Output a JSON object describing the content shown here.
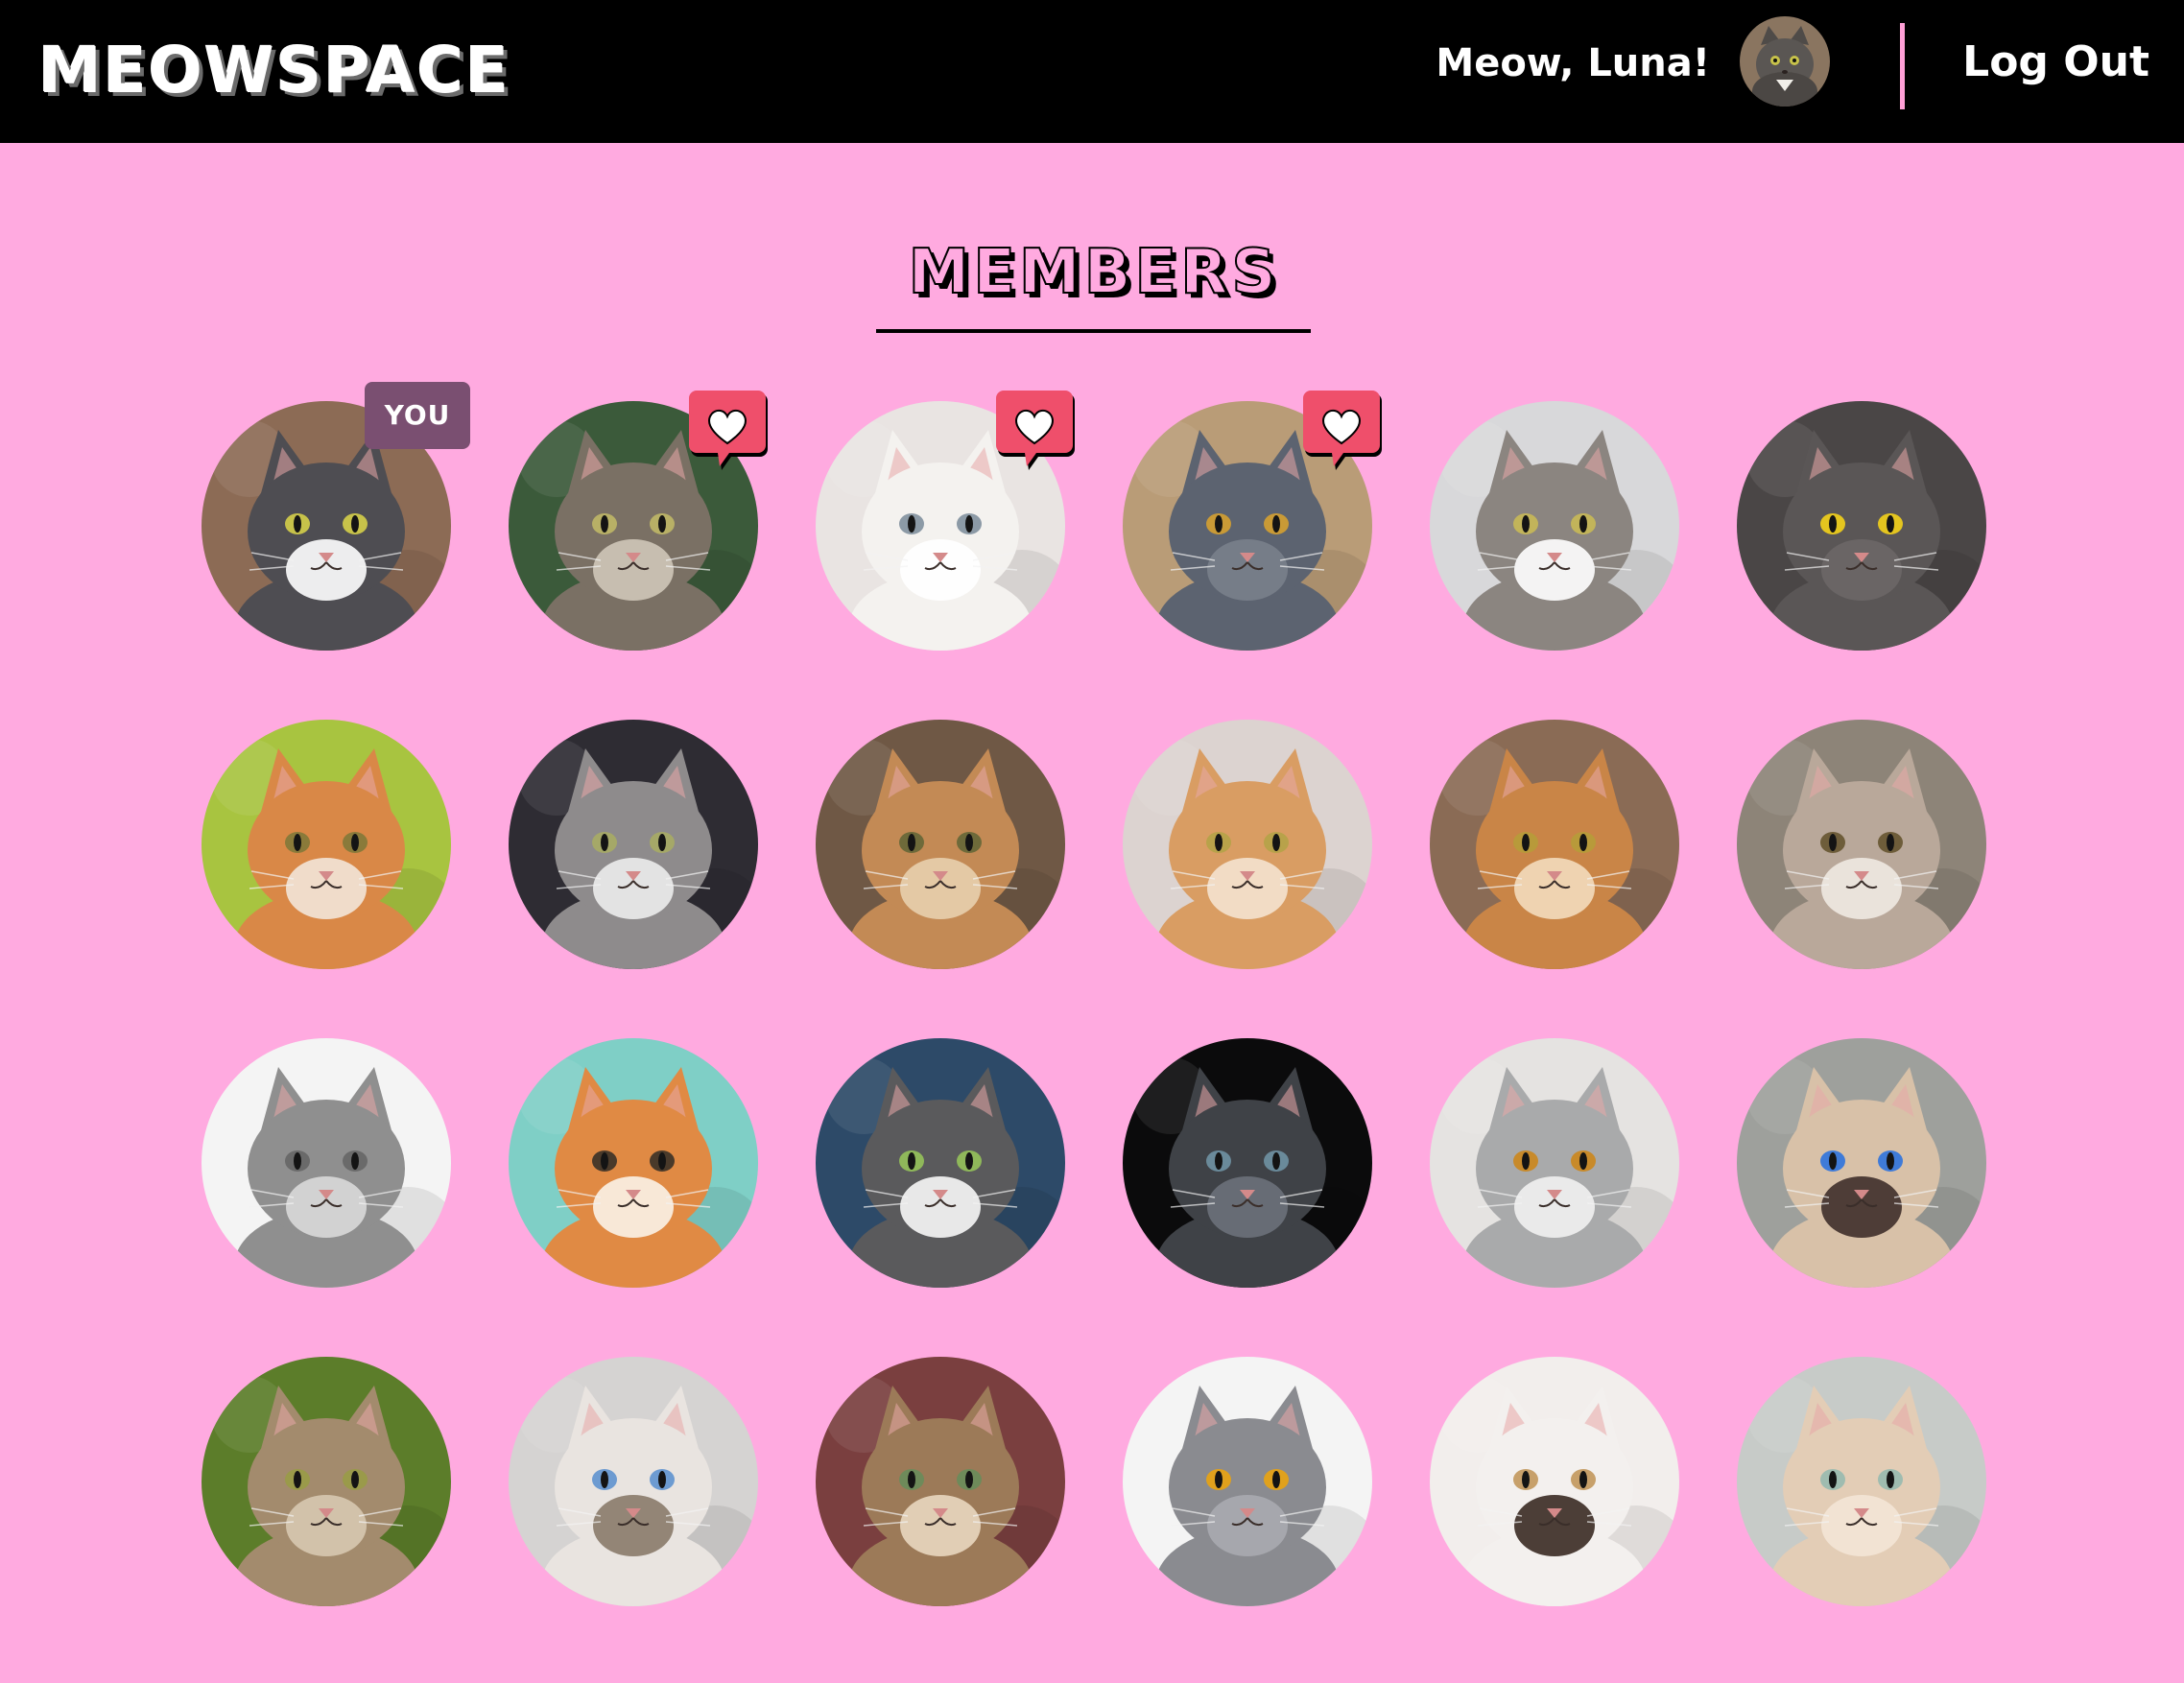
{
  "header": {
    "logo": "MEOWSPACE",
    "greeting": "Meow, Luna!",
    "logout_label": "Log Out",
    "avatar_icon": "cat-avatar-icon",
    "divider_color": "#ff9fd6"
  },
  "main": {
    "title": "MEMBERS",
    "you_badge": "YOU",
    "background_color": "#ffaae0"
  },
  "members": [
    {
      "fur": "#4e4d52",
      "accent": "#ffffff",
      "bg": "#8c6b55",
      "eye": "#c7c24a",
      "badge": "you"
    },
    {
      "fur": "#7a7064",
      "accent": "#cfc6b8",
      "bg": "#3b5a3a",
      "eye": "#b8b066",
      "badge": "heart"
    },
    {
      "fur": "#f4f2ef",
      "accent": "#ffffff",
      "bg": "#e9e4e2",
      "eye": "#8c9aa6",
      "badge": "heart"
    },
    {
      "fur": "#5c6370",
      "accent": "#79808b",
      "bg": "#b99c77",
      "eye": "#c99a36",
      "badge": "heart"
    },
    {
      "fur": "#8b8580",
      "accent": "#ffffff",
      "bg": "#d8d8da",
      "eye": "#c2b45a",
      "badge": null
    },
    {
      "fur": "#5a5656",
      "accent": "#6c6767",
      "bg": "#4a4646",
      "eye": "#e4c51f",
      "badge": null
    },
    {
      "fur": "#d98847",
      "accent": "#f2e6d8",
      "bg": "#a8c440",
      "eye": "#8a7a3a",
      "badge": null
    },
    {
      "fur": "#8e8b8c",
      "accent": "#ececec",
      "bg": "#2e2c33",
      "eye": "#a5a868",
      "badge": null
    },
    {
      "fur": "#c38a55",
      "accent": "#e8cfae",
      "bg": "#6f5845",
      "eye": "#6e6a3a",
      "badge": null
    },
    {
      "fur": "#d99d63",
      "accent": "#f4e3cf",
      "bg": "#dcd3d0",
      "eye": "#b8a24a",
      "badge": null
    },
    {
      "fur": "#c98547",
      "accent": "#f3dcbc",
      "bg": "#8a6b55",
      "eye": "#b89a3a",
      "badge": null
    },
    {
      "fur": "#b9a89a",
      "accent": "#efe9e2",
      "bg": "#8d8478",
      "eye": "#6e5d3a",
      "badge": null
    },
    {
      "fur": "#8f8f8f",
      "accent": "#d9d9d9",
      "bg": "#f4f4f4",
      "eye": "#6a6a6a",
      "badge": null
    },
    {
      "fur": "#e08a44",
      "accent": "#fbf2e8",
      "bg": "#7fcfc6",
      "eye": "#4a3a2a",
      "badge": null
    },
    {
      "fur": "#5a5a5c",
      "accent": "#f7f7f7",
      "bg": "#2d4a68",
      "eye": "#8fb85a",
      "badge": null
    },
    {
      "fur": "#3f4247",
      "accent": "#6c717a",
      "bg": "#0b0b0c",
      "eye": "#6a8a9a",
      "badge": null
    },
    {
      "fur": "#a9aaab",
      "accent": "#f1f1f1",
      "bg": "#e5e3e1",
      "eye": "#c88a2a",
      "badge": null
    },
    {
      "fur": "#d8c1a8",
      "accent": "#3f2f2a",
      "bg": "#9ea09c",
      "eye": "#3f7bd8",
      "badge": null
    },
    {
      "fur": "#a38b6d",
      "accent": "#d7c8b0",
      "bg": "#5c7d2a",
      "eye": "#9a9a4a",
      "badge": null
    },
    {
      "fur": "#e9e4e0",
      "accent": "#8a7a6a",
      "bg": "#d5d3d2",
      "eye": "#6d9bd1",
      "badge": null
    },
    {
      "fur": "#9c7a58",
      "accent": "#e9d7c0",
      "bg": "#7a3f3f",
      "eye": "#6e8a5a",
      "badge": null
    },
    {
      "fur": "#8a8b90",
      "accent": "#a9aab0",
      "bg": "#f4f4f4",
      "eye": "#e0a11d",
      "badge": null
    },
    {
      "fur": "#f3f0ee",
      "accent": "#3a2a22",
      "bg": "#f2eeec",
      "eye": "#c7a06a",
      "badge": null
    },
    {
      "fur": "#e3cdb6",
      "accent": "#f3e6d6",
      "bg": "#c7cbc8",
      "eye": "#9fbcb0",
      "badge": null
    }
  ]
}
